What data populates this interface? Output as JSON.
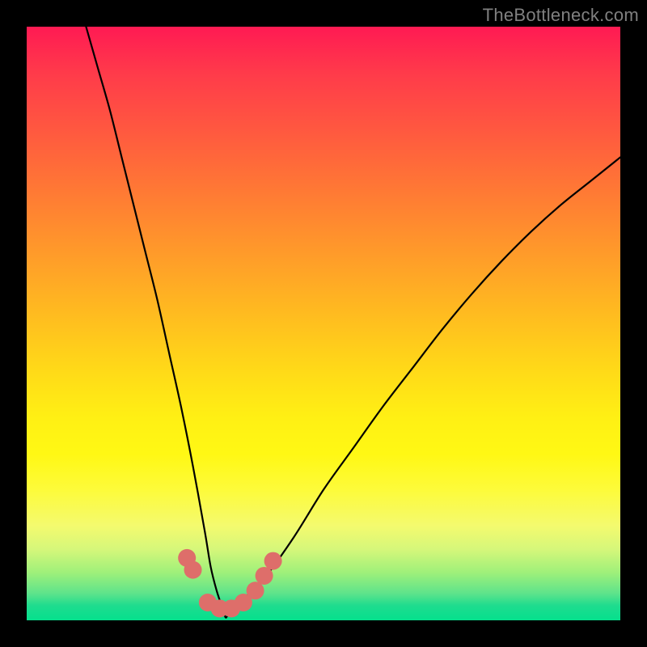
{
  "watermark": "TheBottleneck.com",
  "chart_data": {
    "type": "line",
    "title": "",
    "xlabel": "",
    "ylabel": "",
    "ylim": [
      0,
      100
    ],
    "xlim": [
      0,
      100
    ],
    "series": [
      {
        "name": "valley-curve",
        "x": [
          10,
          12,
          14,
          16,
          18,
          20,
          22,
          24,
          26,
          28,
          30,
          31,
          32,
          33,
          33.5,
          34,
          36,
          38,
          40,
          45,
          50,
          55,
          60,
          65,
          70,
          75,
          80,
          85,
          90,
          95,
          100
        ],
        "y": [
          100,
          93,
          86,
          78,
          70,
          62,
          54,
          45,
          36,
          26,
          15,
          9,
          5,
          2,
          0.5,
          1,
          3,
          5,
          7,
          14,
          22,
          29,
          36,
          42.5,
          49,
          55,
          60.5,
          65.5,
          70,
          74,
          78
        ]
      }
    ],
    "markers": {
      "name": "flat-markers",
      "color": "#de6e6a",
      "points": [
        {
          "x": 27.0,
          "y": 10.5
        },
        {
          "x": 28.0,
          "y": 8.5
        },
        {
          "x": 30.5,
          "y": 3.0
        },
        {
          "x": 32.5,
          "y": 2.0
        },
        {
          "x": 34.5,
          "y": 2.0
        },
        {
          "x": 36.5,
          "y": 3.0
        },
        {
          "x": 38.5,
          "y": 5.0
        },
        {
          "x": 40.0,
          "y": 7.5
        },
        {
          "x": 41.5,
          "y": 10.0
        }
      ]
    },
    "background_gradient": {
      "top": "#ff1a53",
      "mid_upper": "#ff9a2a",
      "mid": "#fff814",
      "mid_lower": "#d6f77a",
      "bottom": "#05e08d"
    }
  }
}
